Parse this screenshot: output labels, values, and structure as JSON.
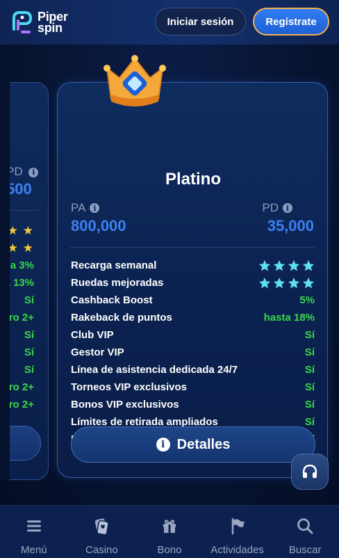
{
  "header": {
    "logo_line1": "Piper",
    "logo_line2": "spin",
    "login_label": "Iniciar sesión",
    "register_label": "Regístrate"
  },
  "side_card": {
    "pd_label": "PD",
    "pd_value": "500",
    "rows": [
      "★ ★",
      "★ ★",
      "a 3%",
      "a 13%",
      "Sí",
      "ro 2+",
      "Sí",
      "Sí",
      "Sí",
      "ro 2+",
      "ro 2+"
    ]
  },
  "card": {
    "title": "Platino",
    "pa_label": "PA",
    "pa_value": "800,000",
    "pd_label": "PD",
    "pd_value": "35,000",
    "features": [
      {
        "label": "Recarga semanal",
        "value": "",
        "stars": 4
      },
      {
        "label": "Ruedas mejoradas",
        "value": "",
        "stars": 4
      },
      {
        "label": "Cashback Boost",
        "value": "5%"
      },
      {
        "label": "Rakeback de puntos",
        "value": "hasta 18%"
      },
      {
        "label": "Club VIP",
        "value": "Sí"
      },
      {
        "label": "Gestor VIP",
        "value": "Sí"
      },
      {
        "label": "Línea de asistencia dedicada 24/7",
        "value": "Sí"
      },
      {
        "label": "Torneos VIP exclusivos",
        "value": "Sí"
      },
      {
        "label": "Bonos VIP exclusivos",
        "value": "Sí"
      },
      {
        "label": "Límites de retirada ampliados",
        "value": "Sí"
      },
      {
        "label": "Prioridad en la cola de retiradas",
        "value": "Sí"
      }
    ],
    "details_label": "Detalles"
  },
  "nav": [
    {
      "label": "Menú",
      "icon": "menu-icon"
    },
    {
      "label": "Casino",
      "icon": "casino-icon"
    },
    {
      "label": "Bono",
      "icon": "gift-icon"
    },
    {
      "label": "Actividades",
      "icon": "flag-icon"
    },
    {
      "label": "Buscar",
      "icon": "search-icon"
    }
  ],
  "colors": {
    "accent_blue": "#3d80f0",
    "green": "#3bd84a",
    "star_cyan": "#5fe0f0",
    "star_gold": "#f5c93a",
    "register_border": "#f5b14c"
  }
}
